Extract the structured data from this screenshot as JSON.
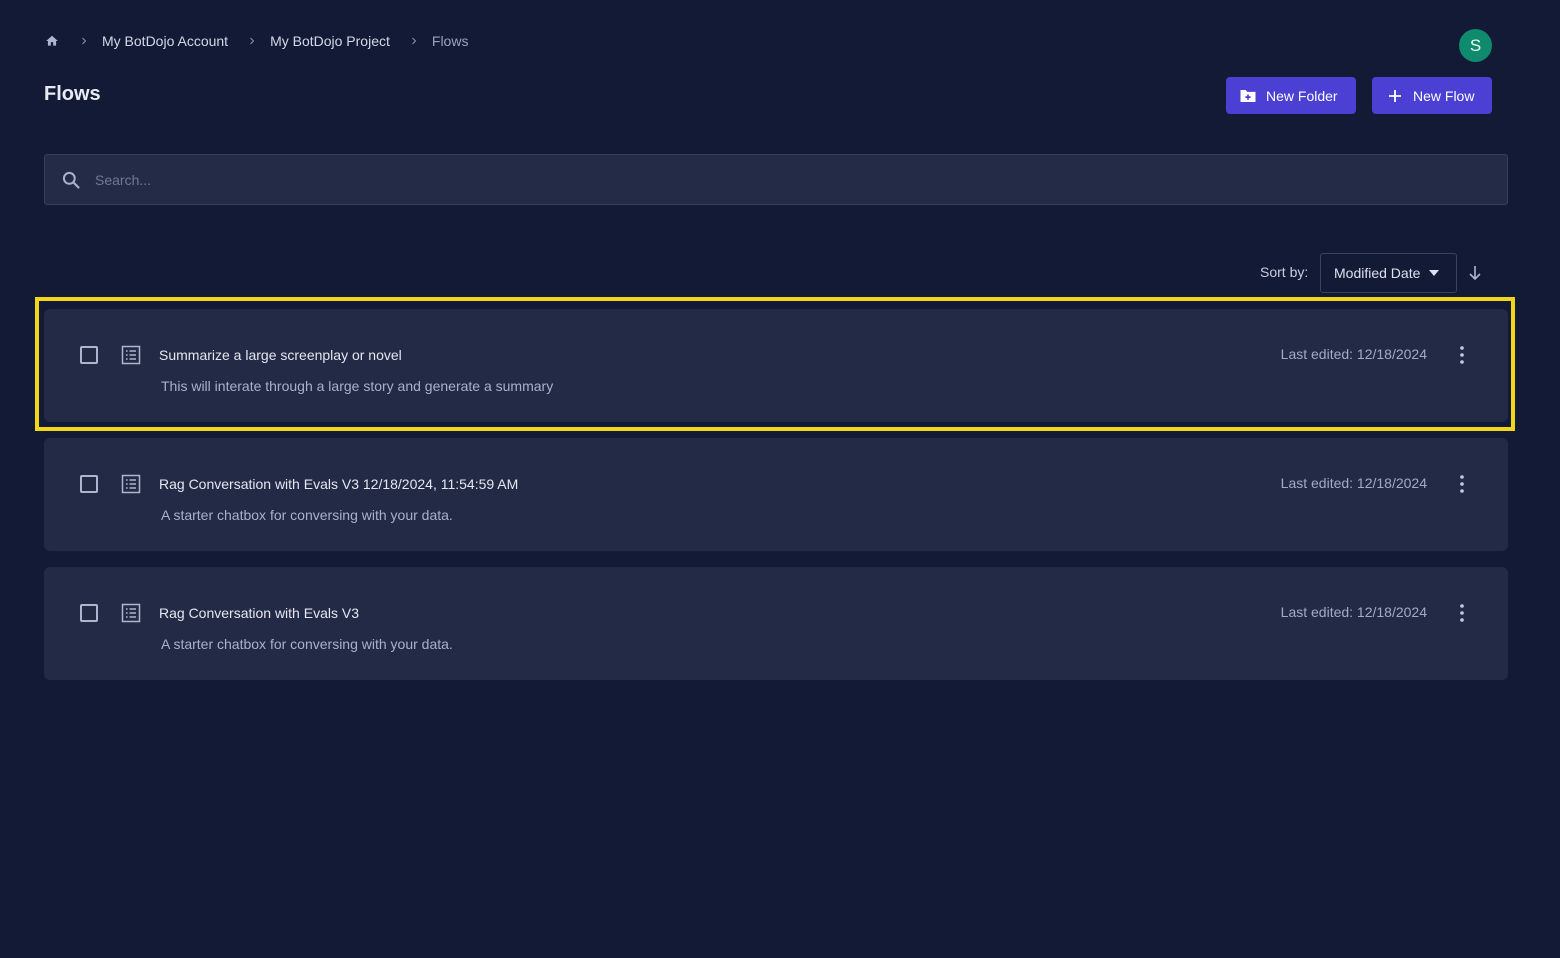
{
  "breadcrumb": {
    "items": [
      {
        "label": "My BotDojo Account"
      },
      {
        "label": "My BotDojo Project"
      }
    ],
    "current": "Flows"
  },
  "avatar": {
    "initial": "S",
    "color": "#0f8a6c"
  },
  "page": {
    "title": "Flows"
  },
  "actions": {
    "new_folder_label": "New Folder",
    "new_flow_label": "New Flow",
    "color": "#4b3fd4"
  },
  "search": {
    "placeholder": "Search..."
  },
  "sort": {
    "label": "Sort by:",
    "selected": "Modified Date",
    "direction": "descending"
  },
  "flows": [
    {
      "title": "Summarize a large screenplay or novel",
      "description": "This will interate through a large story and generate a summary",
      "last_edited": "Last edited: 12/18/2024",
      "highlighted": true
    },
    {
      "title": "Rag Conversation with Evals V3 12/18/2024, 11:54:59 AM",
      "description": "A starter chatbox for conversing with your data.",
      "last_edited": "Last edited: 12/18/2024",
      "highlighted": false
    },
    {
      "title": "Rag Conversation with Evals V3",
      "description": "A starter chatbox for conversing with your data.",
      "last_edited": "Last edited: 12/18/2024",
      "highlighted": false
    }
  ],
  "colors": {
    "background": "#131a35",
    "card": "#232a45",
    "highlight": "#f2d61a"
  }
}
